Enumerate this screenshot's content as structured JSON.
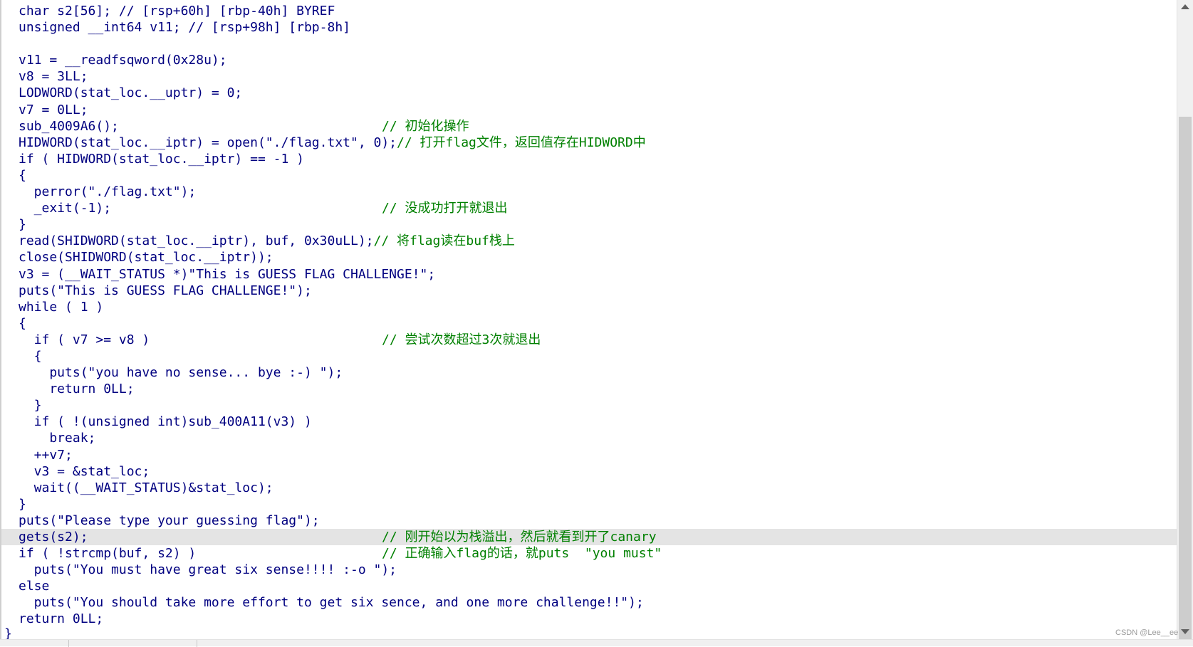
{
  "code": {
    "l0": "char s2[56]; // [rsp+60h] [rbp-40h] BYREF",
    "l1": "unsigned __int64 v11; // [rsp+98h] [rbp-8h]",
    "l3": "v11 = __readfsqword(0x28u);",
    "l4": "v8 = 3LL;",
    "l5": "LODWORD(stat_loc.__uptr) = 0;",
    "l6": "v7 = 0LL;",
    "l7": "sub_4009A6();",
    "l7c": "// 初始化操作",
    "l8": "HIDWORD(stat_loc.__iptr) = open(\"./flag.txt\", 0);",
    "l8c": "// 打开flag文件，返回值存在HIDWORD中",
    "l9": "if ( HIDWORD(stat_loc.__iptr) == -1 )",
    "l10": "{",
    "l11": "  perror(\"./flag.txt\");",
    "l12": "  _exit(-1);",
    "l12c": "// 没成功打开就退出",
    "l13": "}",
    "l14": "read(SHIDWORD(stat_loc.__iptr), buf, 0x30uLL);",
    "l14c": "// 将flag读在buf栈上",
    "l15": "close(SHIDWORD(stat_loc.__iptr));",
    "l16": "v3 = (__WAIT_STATUS *)\"This is GUESS FLAG CHALLENGE!\";",
    "l17": "puts(\"This is GUESS FLAG CHALLENGE!\");",
    "l18": "while ( 1 )",
    "l19": "{",
    "l20": "  if ( v7 >= v8 )",
    "l20c": "// 尝试次数超过3次就退出",
    "l21": "  {",
    "l22": "    puts(\"you have no sense... bye :-) \");",
    "l23": "    return 0LL;",
    "l24": "  }",
    "l25": "  if ( !(unsigned int)sub_400A11(v3) )",
    "l26": "    break;",
    "l27": "  ++v7;",
    "l28": "  v3 = &stat_loc;",
    "l29": "  wait((__WAIT_STATUS)&stat_loc);",
    "l30": "}",
    "l31": "puts(\"Please type your guessing flag\");",
    "l32": "gets(s2);",
    "l32c": "// 刚开始以为栈溢出，然后就看到开了canary",
    "l33": "if ( !strcmp(buf, s2) )",
    "l33c": "// 正确输入flag的话，就puts  \"you must\"",
    "l34": "  puts(\"You must have great six sense!!!! :-o \");",
    "l35": "else",
    "l36": "  puts(\"You should take more effort to get six sence, and one more challenge!!\");",
    "l37": "return 0LL;",
    "l38": "}"
  },
  "watermark": "CSDN @Lee__ee",
  "colors": {
    "background": "#ffffff",
    "code": "#000080",
    "comment": "#008000",
    "variable": "#8080a8",
    "highlight": "#e4e4e4",
    "scrollbar": "#f0f0f0"
  }
}
